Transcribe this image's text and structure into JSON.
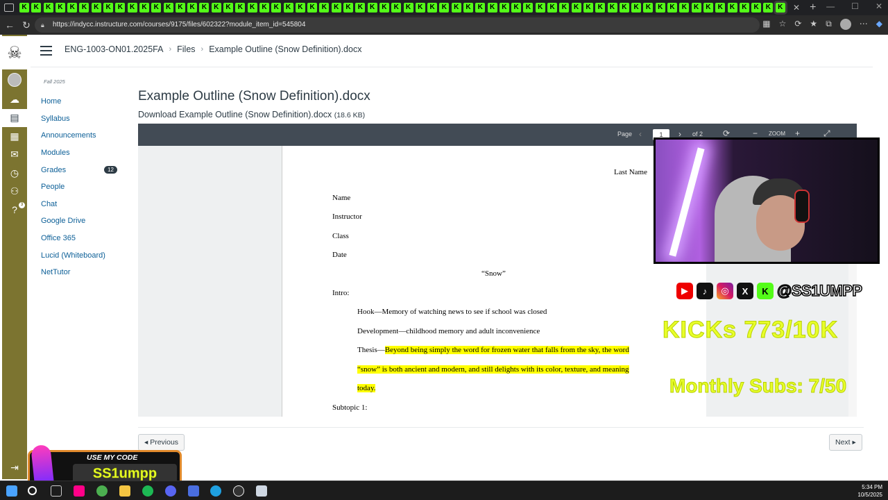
{
  "browser": {
    "url": "https://indycc.instructure.com/courses/9175/files/602322?module_item_id=545804",
    "tab_glyph": "K"
  },
  "breadcrumb": {
    "course": "ENG-1003-ON01.2025FA",
    "files": "Files",
    "current": "Example Outline (Snow Definition).docx"
  },
  "course_nav": {
    "term": "Fall 2025",
    "items": [
      {
        "label": "Home"
      },
      {
        "label": "Syllabus"
      },
      {
        "label": "Announcements"
      },
      {
        "label": "Modules"
      },
      {
        "label": "Grades",
        "badge": "12"
      },
      {
        "label": "People"
      },
      {
        "label": "Chat"
      },
      {
        "label": "Google Drive"
      },
      {
        "label": "Office 365"
      },
      {
        "label": "Lucid (Whiteboard)"
      },
      {
        "label": "NetTutor"
      }
    ]
  },
  "global_nav": {
    "help_badge": "3"
  },
  "file": {
    "title": "Example Outline (Snow Definition).docx",
    "download_label": "Download Example Outline (Snow Definition).docx",
    "size": "(18.6 KB)"
  },
  "viewer": {
    "page_label": "Page",
    "page_value": "1",
    "page_total": "of 2",
    "zoom_label": "ZOOM"
  },
  "document": {
    "last_name": "Last Name",
    "name": "Name",
    "instructor": "Instructor",
    "class": "Class",
    "date": "Date",
    "title": "“Snow”",
    "intro": "Intro:",
    "hook": "Hook—Memory of watching news to see if school was closed",
    "development": "Development—childhood memory and adult inconvenience",
    "thesis_prefix": "Thesis—",
    "thesis_line1": "Beyond being simply the word for frozen water that falls from the sky, the word",
    "thesis_line2": "“snow” is both ancient and modern, and still delights with its color, texture, and meaning",
    "thesis_line3": "today.",
    "subtopic1": "Subtopic 1:"
  },
  "pager": {
    "previous": "◂ Previous",
    "next": "Next ▸"
  },
  "overlay": {
    "handle": "@SS1UMPP",
    "kicks": "KICKs 773/10K",
    "subs": "Monthly Subs: 7/50",
    "promo_title": "USE MY CODE",
    "promo_code": "SS1umpp"
  },
  "taskbar": {
    "time": "5:34 PM",
    "date": "10/5/2025"
  }
}
